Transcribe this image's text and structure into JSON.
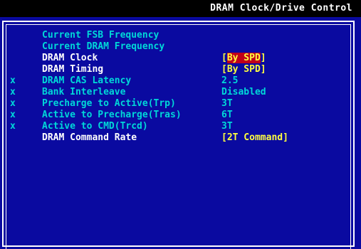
{
  "window": {
    "title": "DRAM Clock/Drive Control"
  },
  "items": [
    {
      "mark": "",
      "label": "Current FSB Frequency",
      "value": "",
      "state": "info"
    },
    {
      "mark": "",
      "label": "Current DRAM Frequency",
      "value": "",
      "state": "info"
    },
    {
      "mark": "",
      "label": "DRAM Clock",
      "value_open": "[",
      "value": "By SPD",
      "value_close": "]",
      "state": "selected"
    },
    {
      "mark": "",
      "label": "DRAM Timing",
      "value_open": "[",
      "value": "By SPD",
      "value_close": "]",
      "state": "editable"
    },
    {
      "mark": "x",
      "label": "DRAM CAS Latency",
      "value": "2.5",
      "state": "disabled"
    },
    {
      "mark": "x",
      "label": "Bank Interleave",
      "value": "Disabled",
      "state": "disabled"
    },
    {
      "mark": "x",
      "label": "Precharge to Active(Trp)",
      "value": "3T",
      "state": "disabled"
    },
    {
      "mark": "x",
      "label": "Active to Precharge(Tras)",
      "value": "6T",
      "state": "disabled"
    },
    {
      "mark": "x",
      "label": "Active to CMD(Trcd)",
      "value": "3T",
      "state": "disabled"
    },
    {
      "mark": "",
      "label": "DRAM Command Rate",
      "value_open": "[",
      "value": "2T Command",
      "value_close": "]",
      "state": "editable"
    }
  ],
  "colors": {
    "background": "#0a0aa0",
    "title_bar": "#000000",
    "info_text": "#00d8d8",
    "label_text": "#ffffff",
    "value_text": "#ffff40",
    "selection": "#c0001a"
  }
}
